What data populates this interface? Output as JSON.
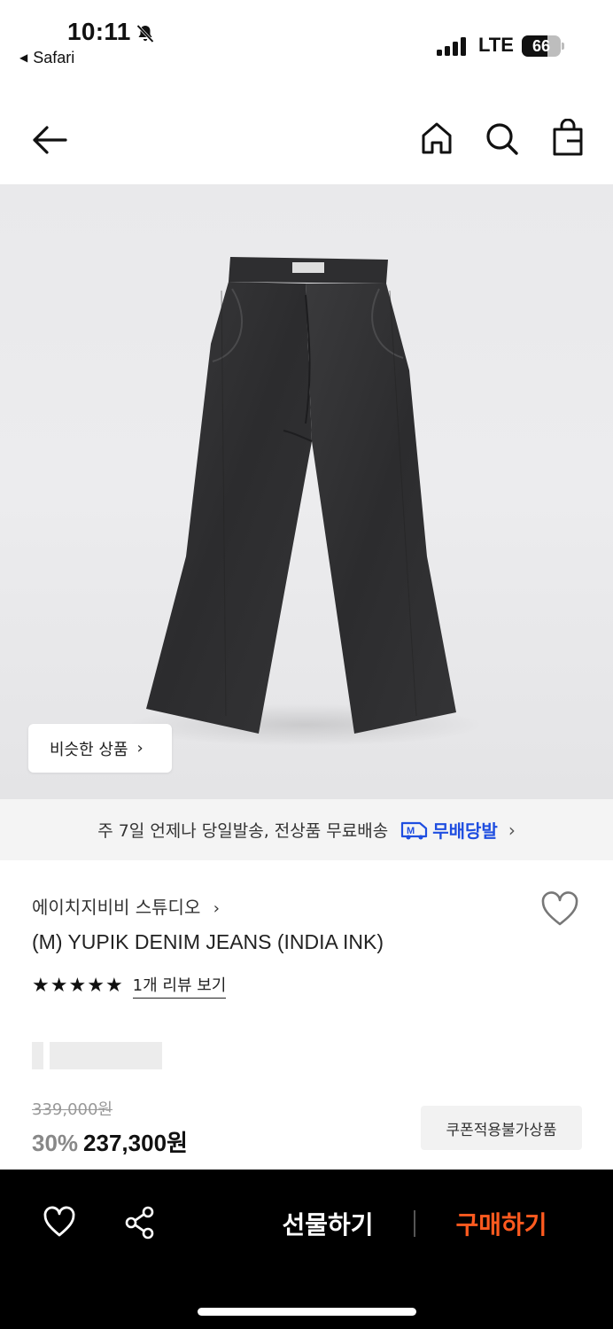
{
  "status_bar": {
    "time": "10:11",
    "back_app": "Safari",
    "network": "LTE",
    "battery": "66",
    "battery_level": 0.66
  },
  "nav": {
    "back_icon": "arrow-left-icon",
    "home_icon": "home-icon",
    "search_icon": "search-icon",
    "bag_icon": "shopping-bag-icon"
  },
  "product_image": {
    "similar_label": "비슷한 상품",
    "similar_chevron": "›"
  },
  "shipping": {
    "text": "주 7일 언제나 당일발송, 전상품 무료배송",
    "badge_label": "무배당발",
    "badge_icon": "truck-m-icon",
    "badge_color": "#1f4ee0",
    "chevron": "›"
  },
  "product": {
    "brand": "에이치지비비 스튜디오",
    "brand_chevron": "›",
    "title": "(M) YUPIK DENIM JEANS (INDIA INK)",
    "rating_stars": 5,
    "review_link": "1개 리뷰 보기",
    "original_price": "339,000원",
    "discount": "30%",
    "price": "237,300원",
    "coupon_note": "쿠폰적용불가상품"
  },
  "bottom_bar": {
    "wish_icon": "heart-icon",
    "share_icon": "share-icon",
    "gift_label": "선물하기",
    "buy_label": "구매하기",
    "buy_color": "#ff5a1f"
  }
}
